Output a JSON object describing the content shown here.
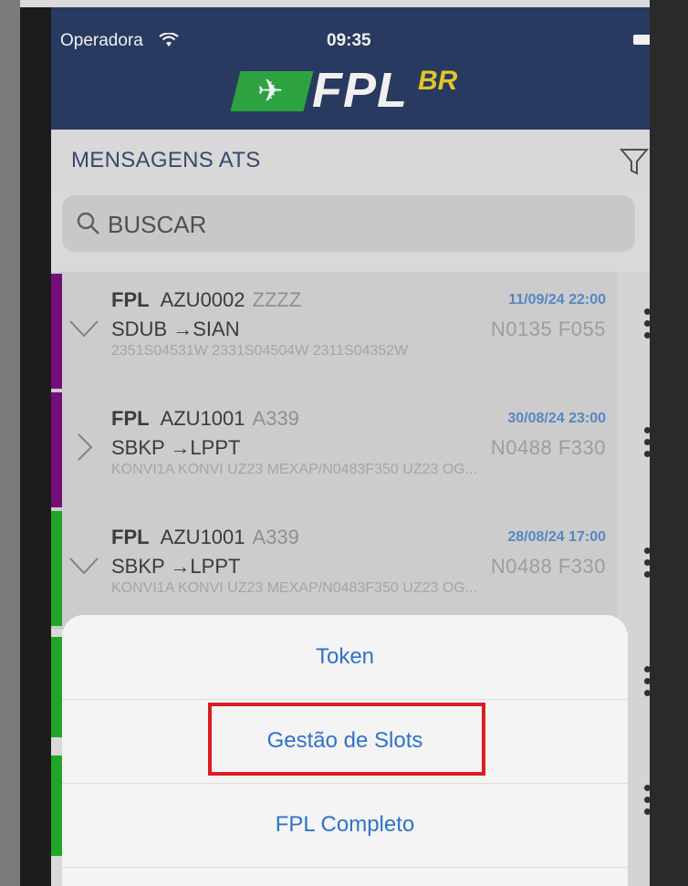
{
  "status_bar": {
    "carrier": "Operadora",
    "time": "09:35"
  },
  "app": {
    "logo_text": "FPL",
    "logo_superscript": "BR",
    "logo_plane_glyph": "✈"
  },
  "title": "MENSAGENS ATS",
  "search": {
    "placeholder": "BUSCAR"
  },
  "colors": {
    "header": "#2c3e66",
    "purple": "#7b0f82",
    "green": "#22b02a",
    "accent_blue": "#2f73c8",
    "highlight": "#dc1c24"
  },
  "messages": [
    {
      "type": "FPL",
      "callsign": "AZU0002",
      "aircraft": "ZZZZ",
      "datetime": "11/09/24 22:00",
      "route": "SDUB →SIAN",
      "speed_level": "N0135 F055",
      "path": "2351S04531W 2331S04504W 2311S04352W",
      "status_color": "purple",
      "expanded": true
    },
    {
      "type": "FPL",
      "callsign": "AZU1001",
      "aircraft": "A339",
      "datetime": "30/08/24 23:00",
      "route": "SBKP →LPPT",
      "speed_level": "N0488 F330",
      "path": "KONVI1A KONVI UZ23 MEXAP/N0483F350 UZ23 OG...",
      "status_color": "purple",
      "expanded": false
    },
    {
      "type": "FPL",
      "callsign": "AZU1001",
      "aircraft": "A339",
      "datetime": "28/08/24 17:00",
      "route": "SBKP →LPPT",
      "speed_level": "N0488 F330",
      "path": "KONVI1A KONVI UZ23 MEXAP/N0483F350 UZ23 OG...",
      "status_color": "green",
      "expanded": true
    }
  ],
  "action_sheet": {
    "items": [
      {
        "label": "Token"
      },
      {
        "label": "Gestão de Slots",
        "highlighted": true
      },
      {
        "label": "FPL Completo"
      }
    ]
  }
}
